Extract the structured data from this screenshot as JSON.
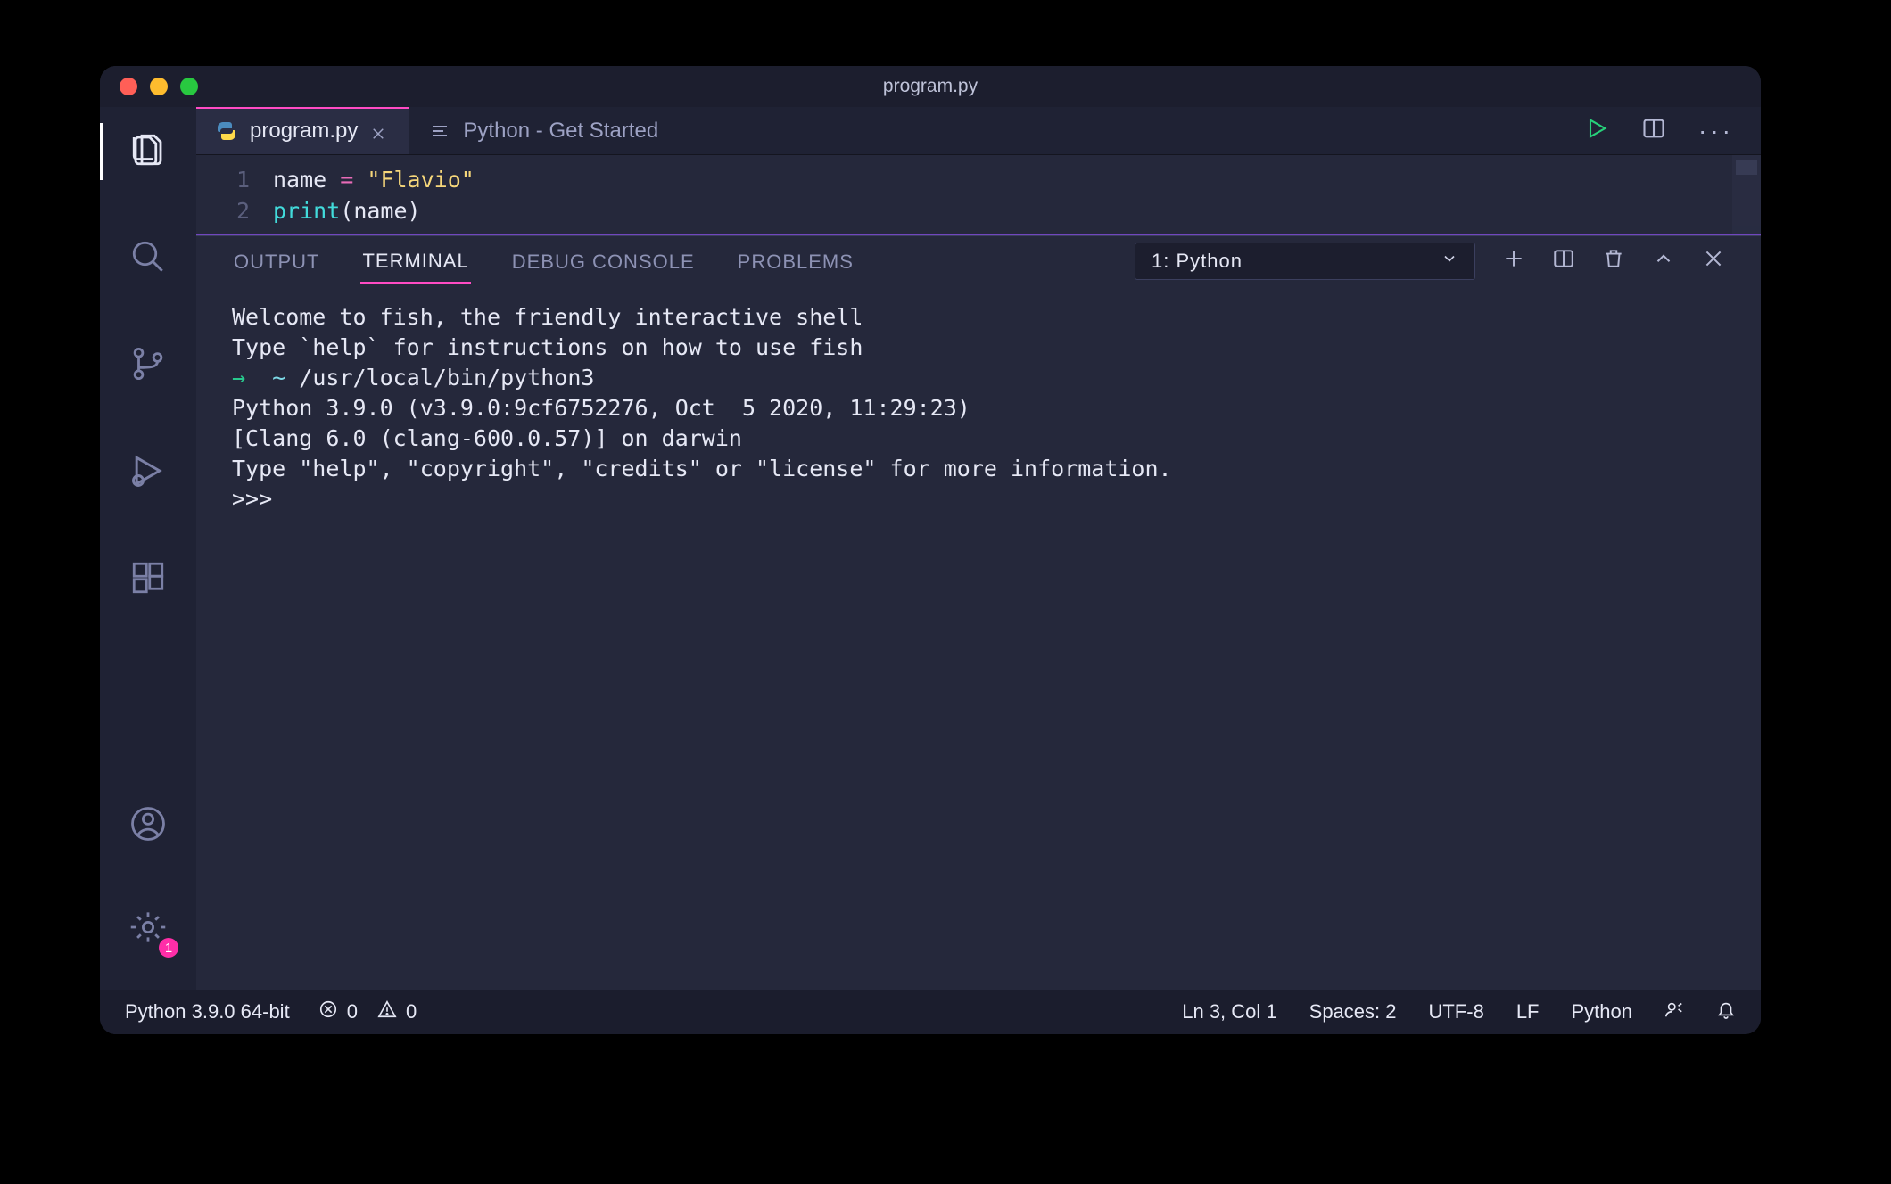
{
  "titlebar": {
    "title": "program.py"
  },
  "activitybar": {
    "top": [
      {
        "name": "explorer",
        "active": true
      },
      {
        "name": "search"
      },
      {
        "name": "source-control"
      },
      {
        "name": "run-debug"
      },
      {
        "name": "extensions"
      }
    ],
    "bottom": [
      {
        "name": "account"
      },
      {
        "name": "settings",
        "badge": "1"
      }
    ]
  },
  "tabs": {
    "items": [
      {
        "label": "program.py",
        "icon": "python",
        "active": true,
        "closable": true
      },
      {
        "label": "Python - Get Started",
        "icon": "menu",
        "active": false,
        "closable": false
      }
    ]
  },
  "editor": {
    "lines": [
      {
        "n": "1",
        "tokens": [
          {
            "cls": "tok-var",
            "t": "name"
          },
          {
            "cls": "",
            "t": " "
          },
          {
            "cls": "tok-op",
            "t": "="
          },
          {
            "cls": "",
            "t": " "
          },
          {
            "cls": "tok-str",
            "t": "\"Flavio\""
          }
        ]
      },
      {
        "n": "2",
        "tokens": [
          {
            "cls": "tok-fn",
            "t": "print"
          },
          {
            "cls": "tok-paren",
            "t": "("
          },
          {
            "cls": "tok-var",
            "t": "name"
          },
          {
            "cls": "tok-paren",
            "t": ")"
          }
        ]
      }
    ]
  },
  "panel": {
    "tabs": [
      {
        "label": "OUTPUT"
      },
      {
        "label": "TERMINAL",
        "active": true
      },
      {
        "label": "DEBUG CONSOLE"
      },
      {
        "label": "PROBLEMS"
      }
    ],
    "terminalSelect": "1: Python"
  },
  "terminal": {
    "lines": [
      "Welcome to fish, the friendly interactive shell",
      "Type `help` for instructions on how to use fish",
      {
        "prompt": true,
        "arrow": "→",
        "tilde": "~",
        "cmd": "/usr/local/bin/python3"
      },
      "Python 3.9.0 (v3.9.0:9cf6752276, Oct  5 2020, 11:29:23)",
      "[Clang 6.0 (clang-600.0.57)] on darwin",
      "Type \"help\", \"copyright\", \"credits\" or \"license\" for more information.",
      ">>>"
    ]
  },
  "statusbar": {
    "python": "Python 3.9.0 64-bit",
    "errors": "0",
    "warnings": "0",
    "position": "Ln 3, Col 1",
    "spaces": "Spaces: 2",
    "encoding": "UTF-8",
    "eol": "LF",
    "lang": "Python"
  }
}
